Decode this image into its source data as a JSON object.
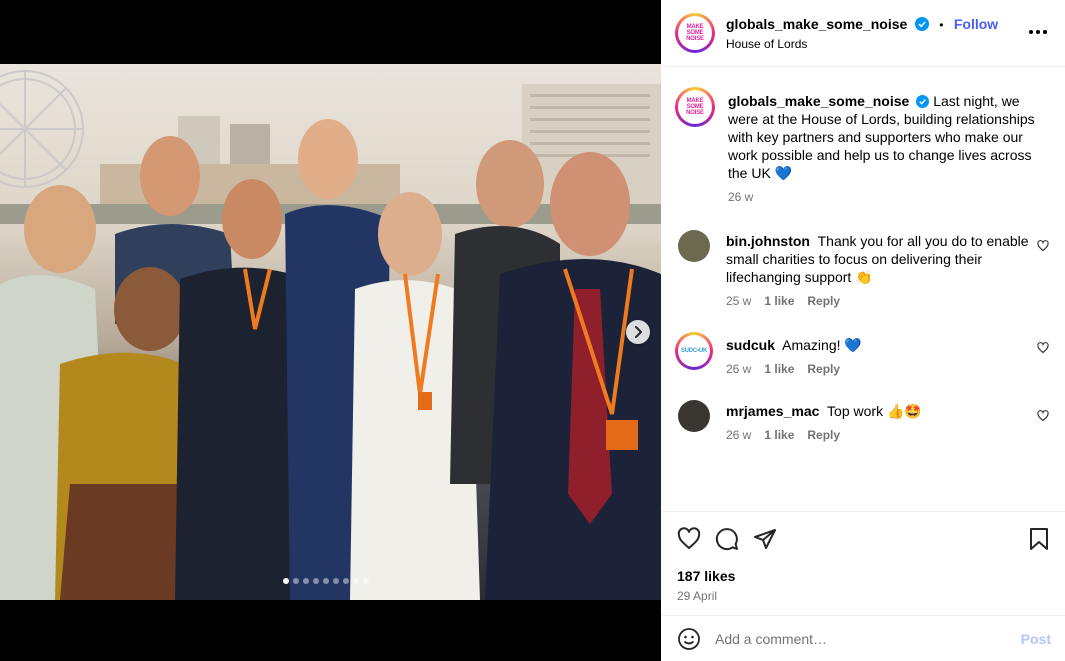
{
  "post": {
    "author": "globals_make_some_noise",
    "avatar_text": "MAKE SOME NOISE",
    "follow_label": "Follow",
    "separator": "•",
    "location": "House of Lords",
    "caption": "Last night, we were at the House of Lords, building relationships with key partners and supporters who make our work possible and help us to change lives across the UK 💙",
    "caption_age": "26 w",
    "likes": "187 likes",
    "date": "29 April",
    "carousel": {
      "slides": 9,
      "active_index": 0
    }
  },
  "comments": [
    {
      "user": "bin.johnston",
      "text": "Thank you for all you do to enable small charities to focus on delivering their lifechanging support 👏",
      "age": "25 w",
      "likes": "1 like",
      "reply": "Reply",
      "avatar_color": "#6b6a4f"
    },
    {
      "user": "sudcuk",
      "text": "Amazing! 💙",
      "age": "26 w",
      "likes": "1 like",
      "reply": "Reply",
      "avatar_color": "#ffffff"
    },
    {
      "user": "mrjames_mac",
      "text": "Top work 👍🤩",
      "age": "26 w",
      "likes": "1 like",
      "reply": "Reply",
      "avatar_color": "#3a3632"
    }
  ],
  "composer": {
    "placeholder": "Add a comment…",
    "post_label": "Post"
  },
  "colors": {
    "accent": "#4a5df9",
    "verified": "#0095f6",
    "muted": "#737373",
    "post_disabled": "#b3c5fb"
  },
  "icons": [
    "more-icon",
    "verified-icon",
    "heart-icon",
    "comment-icon",
    "share-icon",
    "bookmark-icon",
    "emoji-icon",
    "chevron-right-icon"
  ]
}
